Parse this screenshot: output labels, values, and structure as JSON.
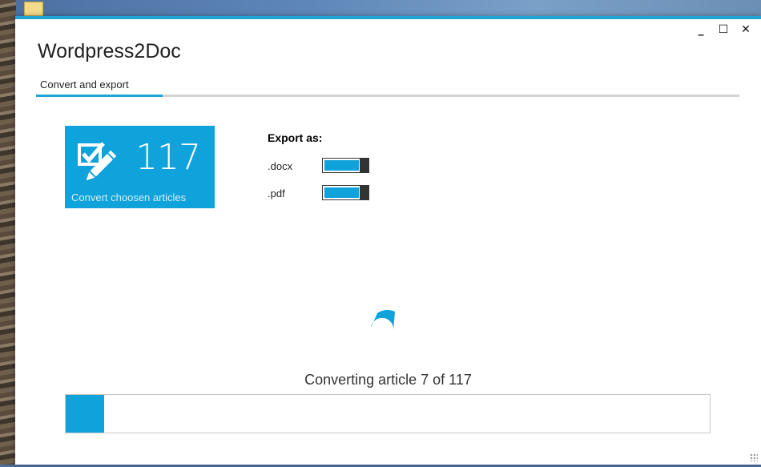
{
  "window": {
    "title": "Wordpress2Doc",
    "controls": {
      "minimize": "_",
      "maximize": "☐",
      "close": "✕"
    }
  },
  "tabs": [
    {
      "label": "Convert and export",
      "active": true
    }
  ],
  "tile": {
    "count": "117",
    "caption": "Convert choosen articles",
    "icon": "checkbox-pencil-icon",
    "color": "#0fa2db"
  },
  "export": {
    "heading": "Export as:",
    "options": [
      {
        "label": ".docx",
        "enabled": true
      },
      {
        "label": ".pdf",
        "enabled": true
      }
    ]
  },
  "progress": {
    "status": "Converting article 7 of 117",
    "current": 7,
    "total": 117,
    "fraction": 0.06
  },
  "colors": {
    "accent": "#1ea5d8",
    "tile": "#0fa2db",
    "track": "#d4d4d4"
  }
}
